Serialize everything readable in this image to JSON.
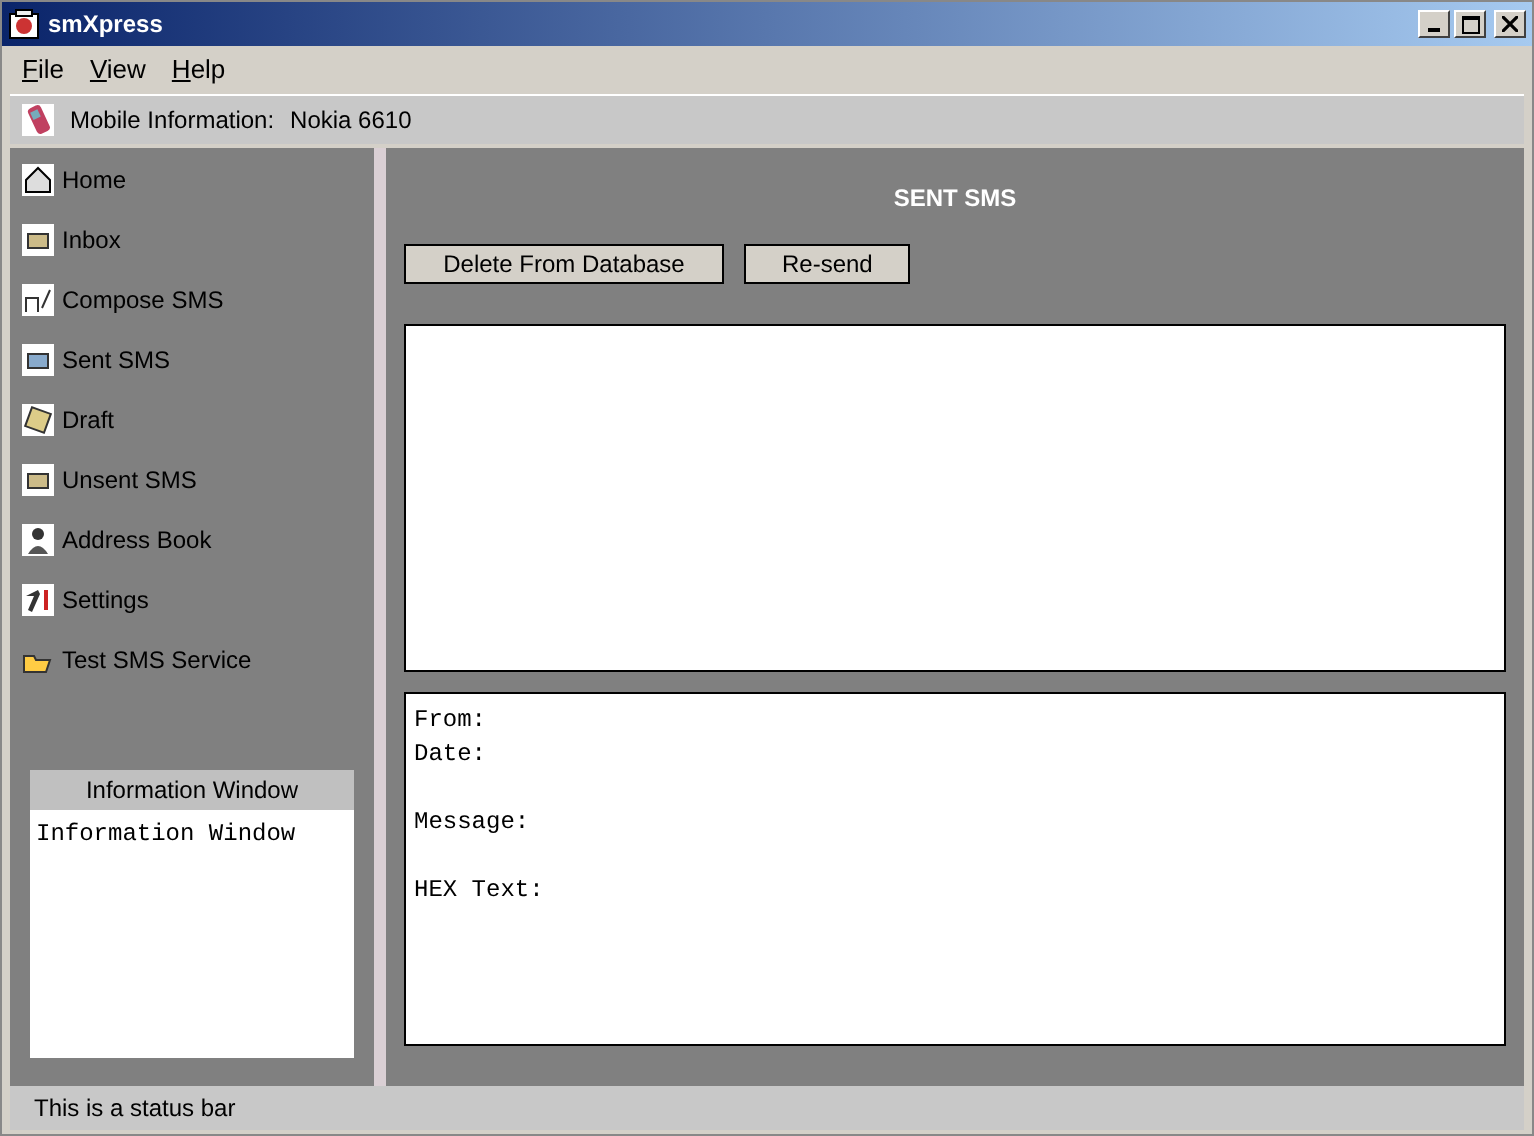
{
  "window": {
    "title": "smXpress"
  },
  "menu": [
    {
      "label": "File"
    },
    {
      "label": "View"
    },
    {
      "label": "Help"
    }
  ],
  "info_bar": {
    "label": "Mobile Information:",
    "value": "Nokia 6610"
  },
  "sidebar": {
    "items": [
      {
        "label": "Home"
      },
      {
        "label": "Inbox"
      },
      {
        "label": "Compose SMS"
      },
      {
        "label": "Sent SMS"
      },
      {
        "label": "Draft"
      },
      {
        "label": "Unsent SMS"
      },
      {
        "label": "Address Book"
      },
      {
        "label": "Settings"
      },
      {
        "label": "Test SMS Service"
      }
    ],
    "info_window": {
      "title": "Information Window",
      "text": "Information Window"
    }
  },
  "content": {
    "title": "SENT SMS",
    "buttons": [
      "Delete From Database",
      "Re-send"
    ],
    "detail_groups": [
      [
        "From:",
        "Date:"
      ],
      [
        "Message:"
      ],
      [
        "HEX Text:"
      ]
    ]
  },
  "status_bar": "This is a status bar"
}
